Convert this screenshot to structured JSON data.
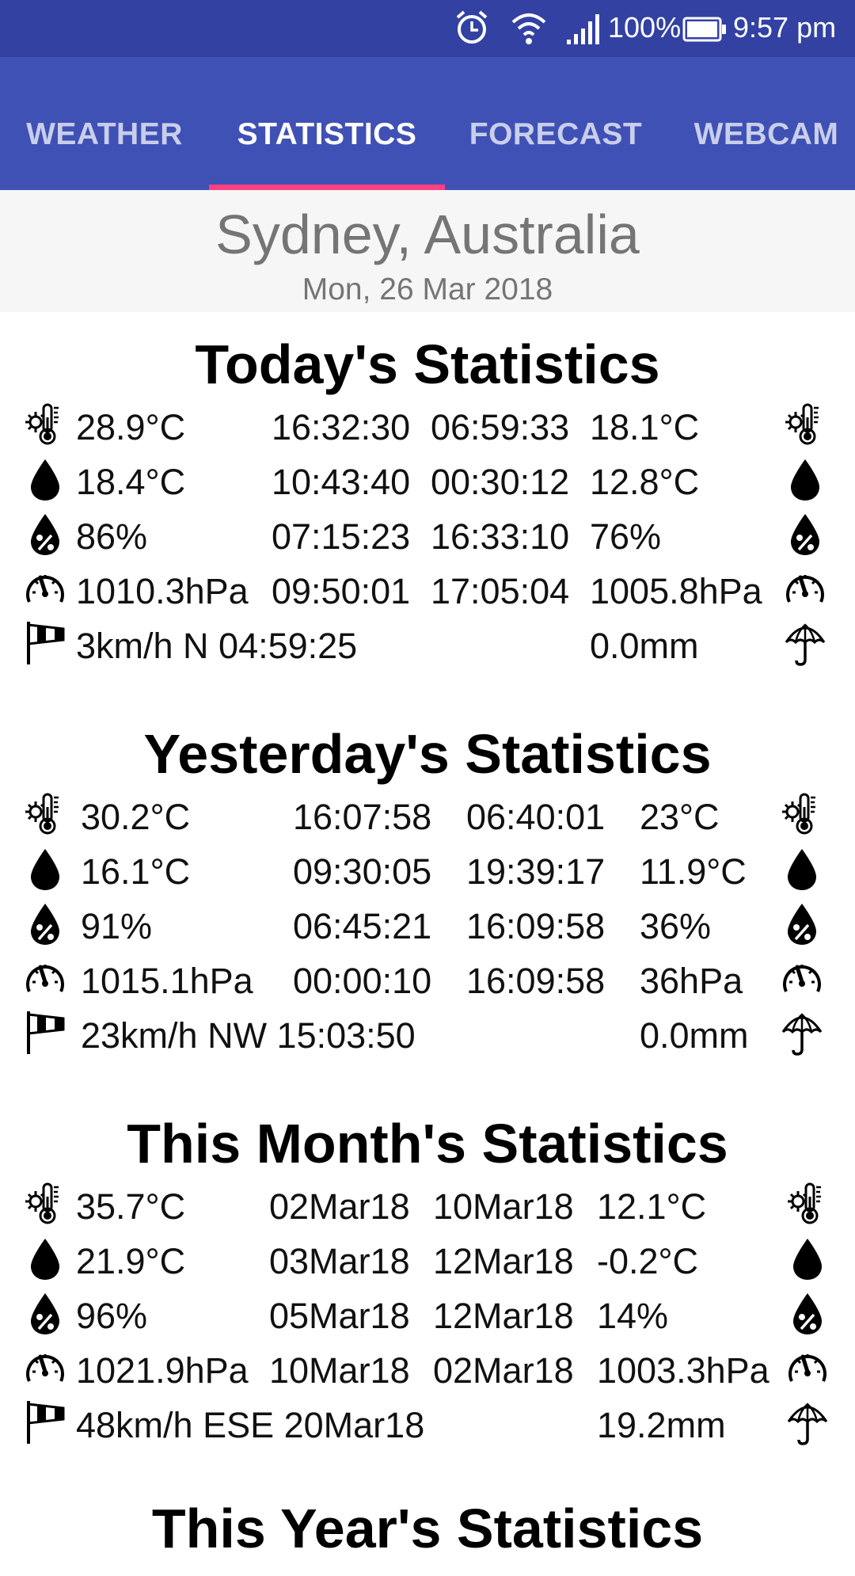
{
  "status_bar": {
    "battery": "100%",
    "time": "9:57 pm",
    "icons": [
      "alarm-icon",
      "wifi-icon",
      "signal-icon",
      "battery-icon"
    ]
  },
  "tabs": [
    {
      "label": "WEATHER",
      "active": false
    },
    {
      "label": "STATISTICS",
      "active": true
    },
    {
      "label": "FORECAST",
      "active": false
    },
    {
      "label": "WEBCAM",
      "active": false
    }
  ],
  "header": {
    "city": "Sydney, Australia",
    "date": "Mon, 26 Mar 2018"
  },
  "accent_colors": {
    "primary": "#3f51b5",
    "primary_dark": "#3341a3",
    "tab_indicator": "#ff4081"
  },
  "sections": [
    {
      "title": "Today's Statistics",
      "rows": [
        {
          "icon": "thermometer-icon",
          "high": "28.9°C",
          "high_time": "16:32:30",
          "low_time": "06:59:33",
          "low": "18.1°C",
          "right_icon": "thermometer-icon"
        },
        {
          "icon": "dewpoint-drop-icon",
          "high": "18.4°C",
          "high_time": "10:43:40",
          "low_time": "00:30:12",
          "low": "12.8°C",
          "right_icon": "dewpoint-drop-icon"
        },
        {
          "icon": "humidity-icon",
          "high": "86%",
          "high_time": "07:15:23",
          "low_time": "16:33:10",
          "low": "76%",
          "right_icon": "humidity-icon"
        },
        {
          "icon": "barometer-icon",
          "high": "1010.3hPa",
          "high_time": "09:50:01",
          "low_time": "17:05:04",
          "low": "1005.8hPa",
          "right_icon": "barometer-icon"
        },
        {
          "icon": "windsock-icon",
          "high": "3km/h N 04:59:25",
          "high_time": "",
          "low_time": "",
          "low": "0.0mm",
          "right_icon": "umbrella-icon"
        }
      ]
    },
    {
      "title": "Yesterday's Statistics",
      "rows": [
        {
          "icon": "thermometer-icon",
          "high": "30.2°C",
          "high_time": "16:07:58",
          "low_time": "06:40:01",
          "low": "23°C",
          "right_icon": "thermometer-icon"
        },
        {
          "icon": "dewpoint-drop-icon",
          "high": "16.1°C",
          "high_time": "09:30:05",
          "low_time": "19:39:17",
          "low": "11.9°C",
          "right_icon": "dewpoint-drop-icon"
        },
        {
          "icon": "humidity-icon",
          "high": "91%",
          "high_time": "06:45:21",
          "low_time": "16:09:58",
          "low": "36%",
          "right_icon": "humidity-icon"
        },
        {
          "icon": "barometer-icon",
          "high": "1015.1hPa",
          "high_time": "00:00:10",
          "low_time": "16:09:58",
          "low": "36hPa",
          "right_icon": "barometer-icon"
        },
        {
          "icon": "windsock-icon",
          "high": "23km/h NW 15:03:50",
          "high_time": "",
          "low_time": "",
          "low": "0.0mm",
          "right_icon": "umbrella-icon"
        }
      ]
    },
    {
      "title": "This Month's Statistics",
      "rows": [
        {
          "icon": "thermometer-icon",
          "high": "35.7°C",
          "high_time": "02Mar18",
          "low_time": "10Mar18",
          "low": "12.1°C",
          "right_icon": "thermometer-icon"
        },
        {
          "icon": "dewpoint-drop-icon",
          "high": "21.9°C",
          "high_time": "03Mar18",
          "low_time": "12Mar18",
          "low": "-0.2°C",
          "right_icon": "dewpoint-drop-icon"
        },
        {
          "icon": "humidity-icon",
          "high": "96%",
          "high_time": "05Mar18",
          "low_time": "12Mar18",
          "low": "14%",
          "right_icon": "humidity-icon"
        },
        {
          "icon": "barometer-icon",
          "high": "1021.9hPa",
          "high_time": "10Mar18",
          "low_time": "02Mar18",
          "low": "1003.3hPa",
          "right_icon": "barometer-icon"
        },
        {
          "icon": "windsock-icon",
          "high": "48km/h ESE 20Mar18",
          "high_time": "",
          "low_time": "",
          "low": "19.2mm",
          "right_icon": "umbrella-icon"
        }
      ]
    },
    {
      "title": "This Year's Statistics",
      "rows": []
    }
  ]
}
